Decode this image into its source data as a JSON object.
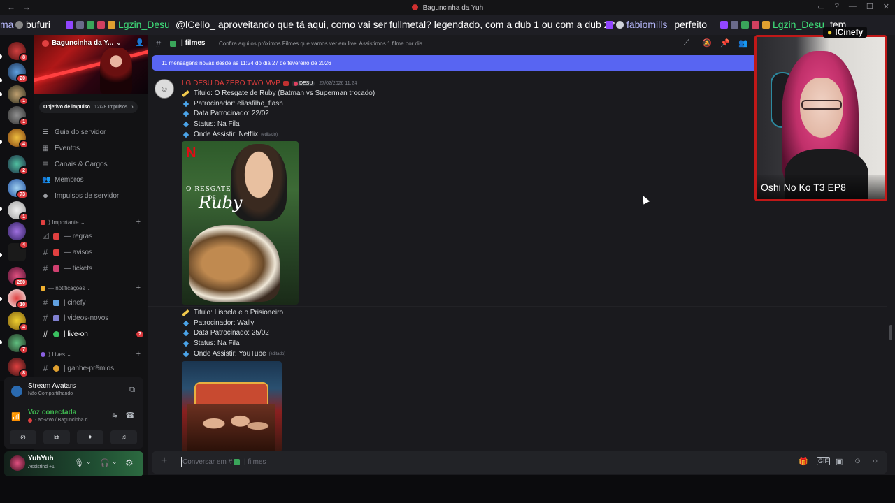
{
  "window": {
    "title": "Baguncinha da Yuh",
    "back_glyph": "←",
    "forward_glyph": "→",
    "controls": [
      "▭",
      "?",
      "—",
      "☐",
      "✕"
    ]
  },
  "stream_chat": {
    "pieces": [
      {
        "user": "ma",
        "text": "",
        "user_color": "#b9bbff"
      },
      {
        "user": "bufuri",
        "text": "",
        "user_color": "#ffffff"
      },
      {
        "user": "Lgzin_Desu",
        "text": "@lCello_ aproveitando que tá aqui, como vai ser fullmetal? legendado, com a dub 1 ou com a dub 2?",
        "user_color": "#3fe07a"
      },
      {
        "user": "fabiomills",
        "text": "perfeito",
        "user_color": "#b9bbff"
      },
      {
        "user": "Lgzin_Desu",
        "text": "tem",
        "user_color": "#3fe07a"
      }
    ]
  },
  "guilds": [
    {
      "count": "8"
    },
    {
      "count": "20"
    },
    {
      "count": "1"
    },
    {
      "count": "1"
    },
    {
      "count": "4"
    },
    {
      "count": "2"
    },
    {
      "count": "73"
    },
    {
      "count": "1"
    },
    {
      "count": ""
    },
    {
      "count": "4"
    },
    {
      "count": "280"
    },
    {
      "count": "10"
    },
    {
      "count": "4"
    },
    {
      "count": "7"
    },
    {
      "count": "8"
    }
  ],
  "sidebar": {
    "server_name": "Baguncinha da Y...",
    "boost_label": "Objetivo de impulso",
    "boost_progress": "12/28 Impulsos",
    "menu": [
      {
        "label": "Guia do servidor",
        "icon": "☰"
      },
      {
        "label": "Eventos",
        "icon": "▦"
      },
      {
        "label": "Canais & Cargos",
        "icon": "≣"
      },
      {
        "label": "Membros",
        "icon": "👥"
      },
      {
        "label": "Impulsos de servidor",
        "icon": "◆"
      }
    ],
    "categories": {
      "important": "Importante",
      "notifications": "notificações",
      "lives": "Lives"
    },
    "channels": {
      "regras": "— regras",
      "avisos": "— avisos",
      "tickets": "— tickets",
      "cinefy": "| cinefy",
      "videos": "| videos-novos",
      "liveon": "| live-on",
      "liveon_unread": "7",
      "ganhe": "| ganhe-prêmios"
    }
  },
  "stream_avatars": {
    "title": "Stream Avatars",
    "subtitle": "Não Compartilhando"
  },
  "voice": {
    "status": "Voz conectada",
    "channel": "- ao-vivo / Baguncinha d..."
  },
  "user": {
    "name": "YuhYuh",
    "status": "Assistind +1"
  },
  "channel": {
    "name": "| filmes",
    "topic": "Confira aqui os próximos Filmes que vamos ver em live! Assistimos 1 filme por dia."
  },
  "new_messages_banner": "11 mensagens novas desde as 11:24 do dia 27 de fevereiro de 2026",
  "message": {
    "author": "LG DESU DA ZERO TWO MVP",
    "tag": "DESU",
    "timestamp": "27/02/2026 11:24",
    "edited": "(editado)",
    "movie1": {
      "title": "Titulo: O Resgate de Ruby  (Batman vs Superman trocado)",
      "sponsor": "Patrocinador: eliasfilho_flash",
      "date": "Data Patrocinado: 22/02",
      "status": "Status: Na Fila",
      "where": "Onde Assistir: Netflix",
      "poster_brand": "N",
      "poster_title_top": "O RESGATE",
      "poster_title_small": "DE",
      "poster_title_main": "Ruby"
    },
    "movie2": {
      "title": "Titulo: Lisbela e o Prisioneiro",
      "sponsor": "Patrocinador: Wally",
      "date": "Data Patrocinado: 25/02",
      "status": "Status: Na Fila",
      "where": "Onde Assistir: YouTube"
    }
  },
  "composer": {
    "placeholder": "Conversar em #",
    "placeholder_channel": "| filmes"
  },
  "webcam": {
    "brand": "lCinefy",
    "caption": "Oshi No Ko T3 EP8"
  }
}
